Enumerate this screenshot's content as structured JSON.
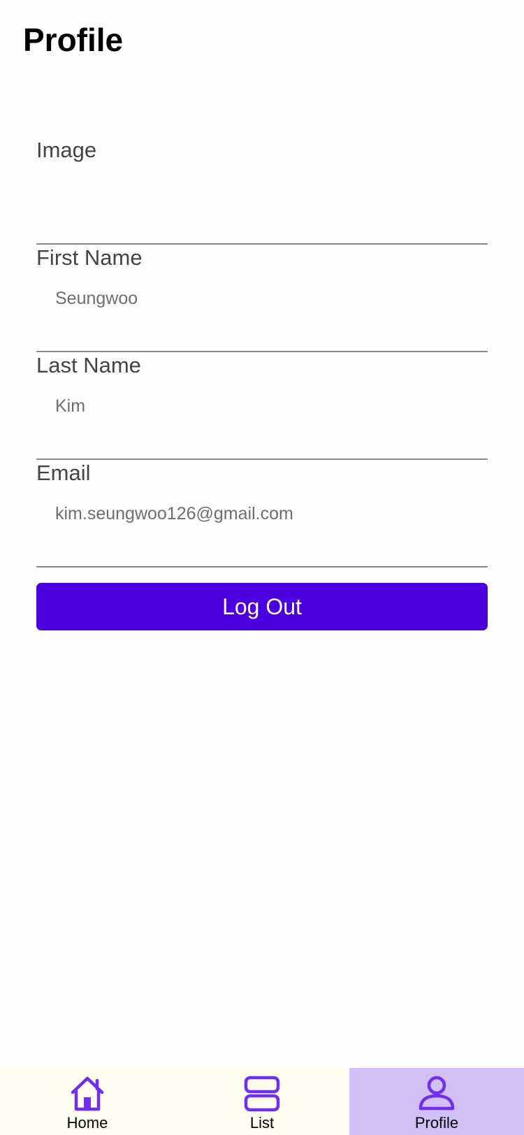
{
  "header": {
    "title": "Profile"
  },
  "form": {
    "fields": [
      {
        "label": "Image",
        "value": ""
      },
      {
        "label": "First Name",
        "value": "Seungwoo"
      },
      {
        "label": "Last Name",
        "value": "Kim"
      },
      {
        "label": "Email",
        "value": "kim.seungwoo126@gmail.com"
      }
    ],
    "logout_label": "Log Out"
  },
  "tabs": [
    {
      "label": "Home",
      "icon": "home-icon",
      "active": false
    },
    {
      "label": "List",
      "icon": "list-icon",
      "active": false
    },
    {
      "label": "Profile",
      "icon": "person-icon",
      "active": true
    }
  ],
  "colors": {
    "accent": "#4b00dd",
    "icon": "#6f2ef0",
    "active_tab_bg": "#d1c0f5",
    "tab_bar_bg": "#fffdf0"
  }
}
